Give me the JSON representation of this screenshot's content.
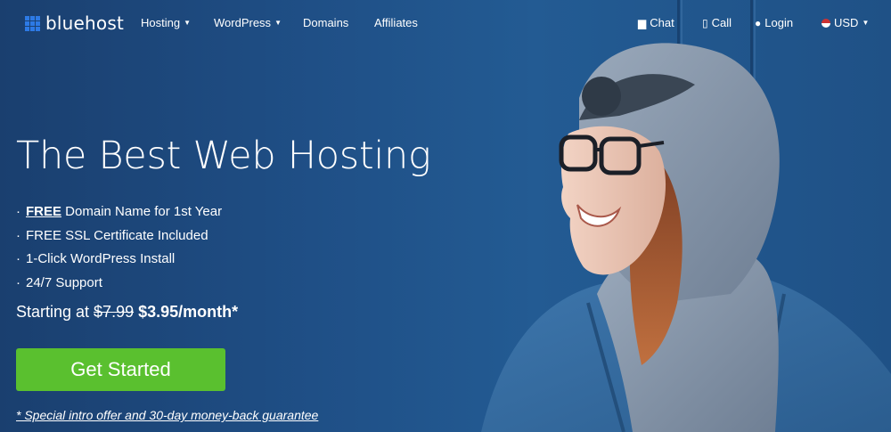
{
  "nav": {
    "logo_text": "bluehost",
    "items": [
      {
        "label": "Hosting",
        "has_dropdown": true
      },
      {
        "label": "WordPress",
        "has_dropdown": true
      },
      {
        "label": "Domains",
        "has_dropdown": false
      },
      {
        "label": "Affiliates",
        "has_dropdown": false
      }
    ],
    "right": {
      "chat": "Chat",
      "call": "Call",
      "login": "Login",
      "currency": "USD"
    }
  },
  "hero": {
    "headline": "The Best Web Hosting",
    "features": [
      {
        "bullet": "·",
        "emph": "FREE",
        "text": " Domain Name for 1st Year"
      },
      {
        "bullet": "·",
        "emph": "",
        "text": "FREE SSL Certificate Included"
      },
      {
        "bullet": "·",
        "emph": "",
        "text": "1-Click WordPress Install"
      },
      {
        "bullet": "·",
        "emph": "",
        "text": "24/7 Support"
      }
    ],
    "price_prefix": "Starting at ",
    "price_old": "$7.99",
    "price_new": "$3.95/month*",
    "cta_label": "Get Started",
    "offer_note": "* Special intro offer and 30-day money-back guarantee"
  },
  "colors": {
    "background": "#1f4f86",
    "cta": "#5ac02f",
    "logo_accent": "#2d7ae5"
  },
  "icons": {
    "chat": "chat-bubble-icon",
    "call": "phone-icon",
    "login": "user-icon",
    "currency": "us-flag-icon"
  }
}
